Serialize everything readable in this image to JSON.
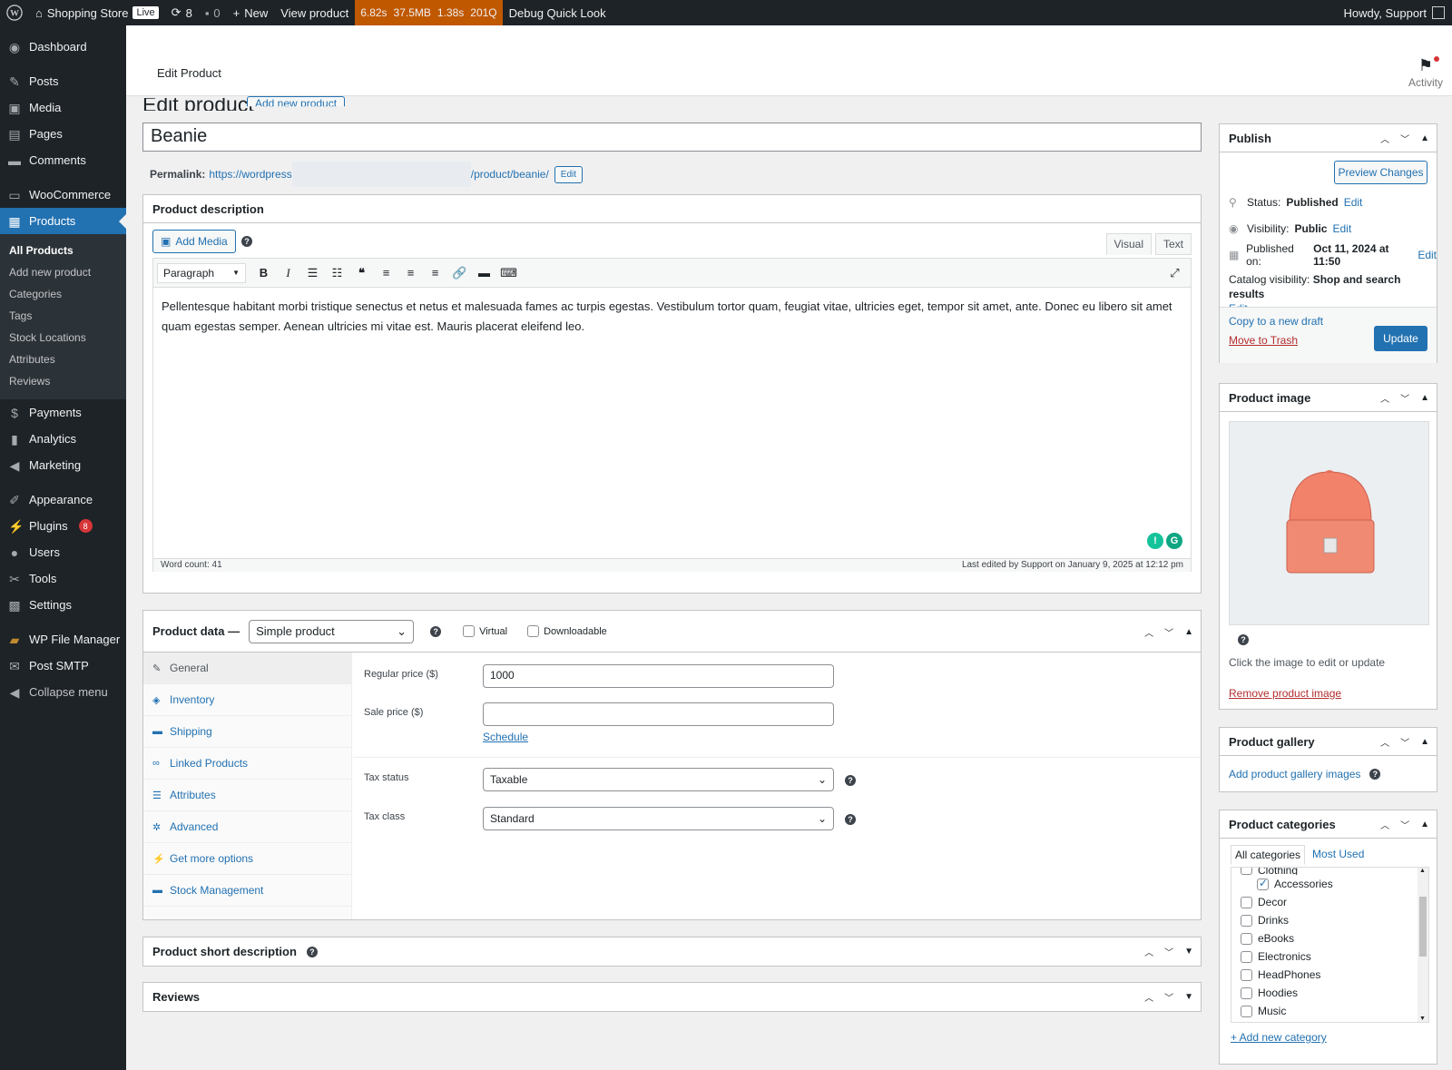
{
  "admin_bar": {
    "site_name": "Shopping Store",
    "live_badge": "Live",
    "updates_count": "8",
    "comments_count": "0",
    "new_label": "New",
    "view_product": "View product",
    "perf": [
      "6.82s",
      "37.5MB",
      "1.38s",
      "201Q"
    ],
    "debug": "Debug Quick Look",
    "howdy": "Howdy, Support"
  },
  "sidebar": {
    "items": [
      {
        "label": "Dashboard",
        "icon": "dashboard-icon"
      },
      {
        "label": "Posts",
        "icon": "pin-icon"
      },
      {
        "label": "Media",
        "icon": "media-icon"
      },
      {
        "label": "Pages",
        "icon": "pages-icon"
      },
      {
        "label": "Comments",
        "icon": "comment-icon"
      },
      {
        "label": "WooCommerce",
        "icon": "woo-icon"
      },
      {
        "label": "Products",
        "icon": "archive-icon"
      },
      {
        "label": "Payments",
        "icon": "payments-icon"
      },
      {
        "label": "Analytics",
        "icon": "chart-icon"
      },
      {
        "label": "Marketing",
        "icon": "megaphone-icon"
      },
      {
        "label": "Appearance",
        "icon": "brush-icon"
      },
      {
        "label": "Plugins",
        "icon": "plug-icon",
        "badge": "8"
      },
      {
        "label": "Users",
        "icon": "user-icon"
      },
      {
        "label": "Tools",
        "icon": "wrench-icon"
      },
      {
        "label": "Settings",
        "icon": "settings-icon"
      },
      {
        "label": "WP File Manager",
        "icon": "folder-icon"
      },
      {
        "label": "Post SMTP",
        "icon": "mail-icon"
      },
      {
        "label": "Collapse menu",
        "icon": "collapse-icon"
      }
    ],
    "submenu": [
      "All Products",
      "Add new product",
      "Categories",
      "Tags",
      "Stock Locations",
      "Attributes",
      "Reviews"
    ]
  },
  "header": {
    "title": "Edit Product",
    "activity": "Activity"
  },
  "page": {
    "heading": "Edit product",
    "add_new": "Add new product",
    "product_title": "Beanie",
    "permalink_label": "Permalink:",
    "permalink_start": "https://wordpress",
    "permalink_end": "/product/beanie/",
    "edit": "Edit"
  },
  "description": {
    "title": "Product description",
    "add_media": "Add Media",
    "tab_visual": "Visual",
    "tab_text": "Text",
    "format": "Paragraph",
    "body": "Pellentesque habitant morbi tristique senectus et netus et malesuada fames ac turpis egestas. Vestibulum tortor quam, feugiat vitae, ultricies eget, tempor sit amet, ante. Donec eu libero sit amet quam egestas semper. Aenean ultricies mi vitae est. Mauris placerat eleifend leo.",
    "word_count": "Word count: 41",
    "last_edited": "Last edited by Support on January 9, 2025 at 12:12 pm"
  },
  "product_data": {
    "title": "Product data —",
    "type": "Simple product",
    "virtual": "Virtual",
    "downloadable": "Downloadable",
    "tabs": [
      "General",
      "Inventory",
      "Shipping",
      "Linked Products",
      "Attributes",
      "Advanced",
      "Get more options",
      "Stock Management"
    ],
    "regular_price_label": "Regular price ($)",
    "regular_price": "1000",
    "sale_price_label": "Sale price ($)",
    "sale_price": "",
    "schedule": "Schedule",
    "tax_status_label": "Tax status",
    "tax_status": "Taxable",
    "tax_class_label": "Tax class",
    "tax_class": "Standard"
  },
  "short_description": {
    "title": "Product short description"
  },
  "reviews": {
    "title": "Reviews"
  },
  "publish": {
    "title": "Publish",
    "preview": "Preview Changes",
    "status_label": "Status:",
    "status": "Published",
    "visibility_label": "Visibility:",
    "visibility": "Public",
    "published_label": "Published on:",
    "published": "Oct 11, 2024 at 11:50",
    "catalog_label": "Catalog visibility:",
    "catalog": "Shop and search results",
    "edit": "Edit",
    "copy_draft": "Copy to a new draft",
    "trash": "Move to Trash",
    "update": "Update"
  },
  "product_image": {
    "title": "Product image",
    "hint": "Click the image to edit or update",
    "remove": "Remove product image"
  },
  "gallery": {
    "title": "Product gallery",
    "add": "Add product gallery images"
  },
  "categories": {
    "title": "Product categories",
    "tab_all": "All categories",
    "tab_most": "Most Used",
    "partial": "Clothing",
    "items": [
      {
        "label": "Accessories",
        "checked": true
      },
      {
        "label": "Decor",
        "checked": false
      },
      {
        "label": "Drinks",
        "checked": false
      },
      {
        "label": "eBooks",
        "checked": false
      },
      {
        "label": "Electronics",
        "checked": false
      },
      {
        "label": "HeadPhones",
        "checked": false
      },
      {
        "label": "Hoodies",
        "checked": false
      },
      {
        "label": "Music",
        "checked": false
      }
    ],
    "add_new": "+ Add new category"
  },
  "colors": {
    "accent": "#2271b1",
    "admin_bar": "#1d2327",
    "perf": "#c05800",
    "danger": "#d63638"
  }
}
